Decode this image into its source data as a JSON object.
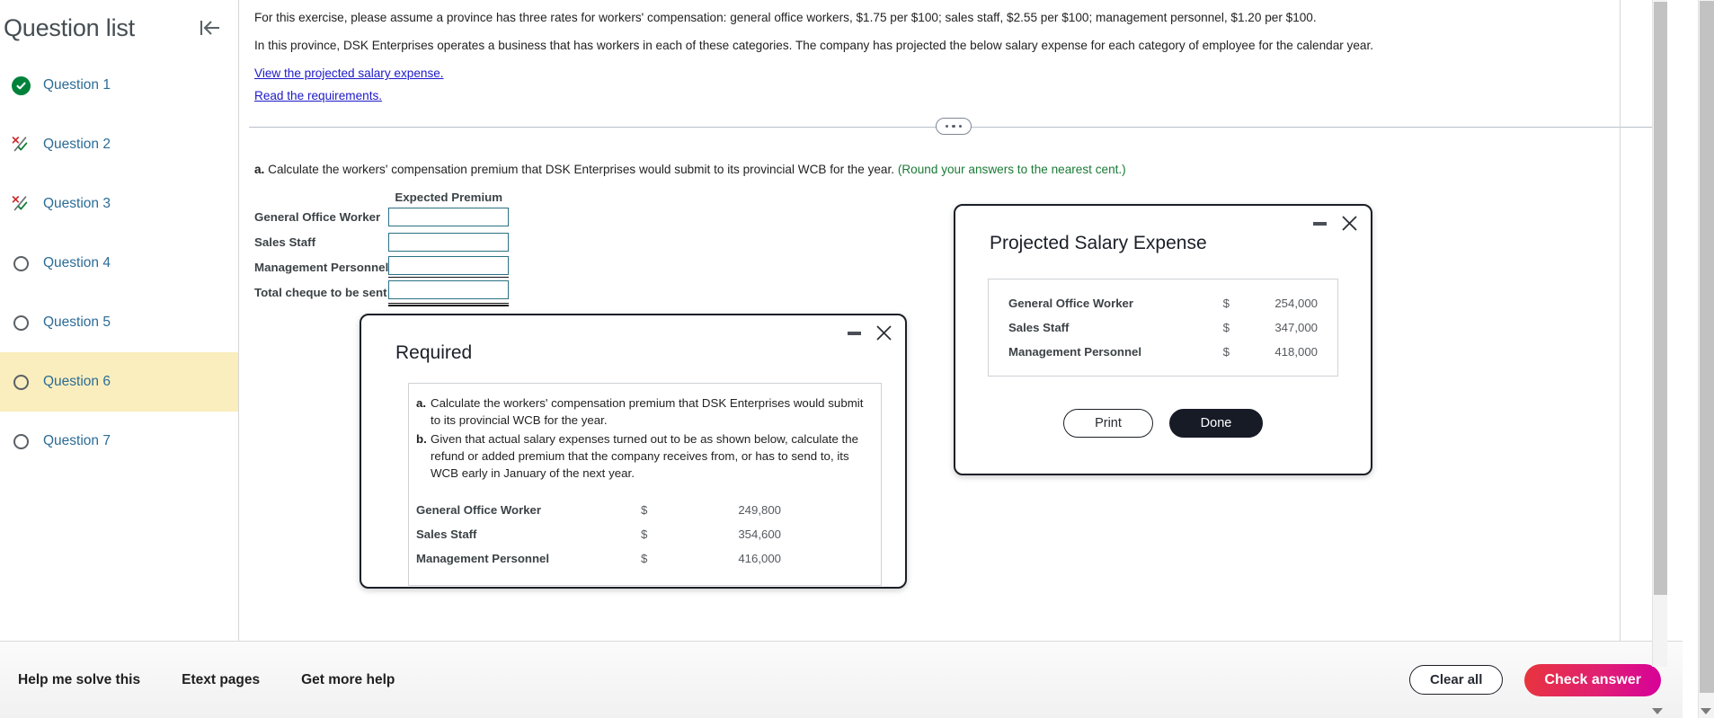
{
  "sidebar": {
    "title": "Question list",
    "collapse_icon": "collapse-panel-icon",
    "items": [
      {
        "label": "Question 1",
        "status": "complete",
        "active": false
      },
      {
        "label": "Question 2",
        "status": "partial",
        "active": false
      },
      {
        "label": "Question 3",
        "status": "partial",
        "active": false
      },
      {
        "label": "Question 4",
        "status": "empty",
        "active": false
      },
      {
        "label": "Question 5",
        "status": "empty",
        "active": false
      },
      {
        "label": "Question 6",
        "status": "empty",
        "active": true
      },
      {
        "label": "Question 7",
        "status": "empty",
        "active": false
      }
    ]
  },
  "exercise": {
    "paragraph1": "For this exercise, please assume a province has three rates for workers' compensation: general office workers, $1.75 per $100; sales staff, $2.55 per $100; management personnel, $1.20 per $100.",
    "paragraph2": "In this province, DSK Enterprises operates a business that has workers in each of these categories. The company has projected the  below salary expense for each category of employee for the calendar year.",
    "link_view_salary": "View the projected salary expense.",
    "link_read_requirements": "Read the requirements.",
    "more_options_icon": "ellipsis-icon"
  },
  "question": {
    "part_marker": "a.",
    "prompt": "Calculate the workers' compensation premium that DSK Enterprises would submit to its provincial WCB for the year.",
    "hint": "(Round your answers to the nearest cent.)",
    "column_header": "Expected Premium",
    "rows": [
      {
        "label": "General Office Worker",
        "value": "",
        "rule": "none"
      },
      {
        "label": "Sales Staff",
        "value": "",
        "rule": "none"
      },
      {
        "label": "Management Personnel",
        "value": "",
        "rule": "single"
      },
      {
        "label": "Total cheque to be sent",
        "value": "",
        "rule": "double"
      }
    ]
  },
  "modal_salary": {
    "title": "Projected Salary Expense",
    "minimize_icon": "minimize-icon",
    "close_icon": "close-icon",
    "rows": [
      {
        "label": "General Office Worker",
        "currency": "$",
        "amount": "254,000"
      },
      {
        "label": "Sales Staff",
        "currency": "$",
        "amount": "347,000"
      },
      {
        "label": "Management Personnel",
        "currency": "$",
        "amount": "418,000"
      }
    ],
    "print_label": "Print",
    "done_label": "Done"
  },
  "modal_required": {
    "title": "Required",
    "minimize_icon": "minimize-icon",
    "close_icon": "close-icon",
    "items": [
      {
        "marker": "a.",
        "text": "Calculate the workers' compensation premium that DSK Enterprises would submit to its provincial WCB for the year."
      },
      {
        "marker": "b.",
        "text": "Given that actual salary expenses turned out to be as shown below, calculate the refund or added premium that the company receives from, or has to send to, its WCB early in January of the next year."
      }
    ],
    "rows": [
      {
        "label": "General Office Worker",
        "currency": "$",
        "amount": "249,800"
      },
      {
        "label": "Sales Staff",
        "currency": "$",
        "amount": "354,600"
      },
      {
        "label": "Management Personnel",
        "currency": "$",
        "amount": "416,000"
      }
    ]
  },
  "bottombar": {
    "links": [
      {
        "label": "Help me solve this"
      },
      {
        "label": "Etext pages"
      },
      {
        "label": "Get more help"
      }
    ],
    "clear_all_label": "Clear all",
    "check_answer_label": "Check answer"
  },
  "colors": {
    "sidebar_link": "#2b6c96",
    "active_row": "#faeebe",
    "complete_green": "#00823b",
    "partial_red": "#cc2b2b",
    "hint_green": "#1a7a35",
    "link_blue": "#1d19c8",
    "field_border": "#2a7284",
    "check_answer_gradient_start": "#e8353c",
    "check_answer_gradient_end": "#d6009a",
    "done_button": "#161b26"
  }
}
